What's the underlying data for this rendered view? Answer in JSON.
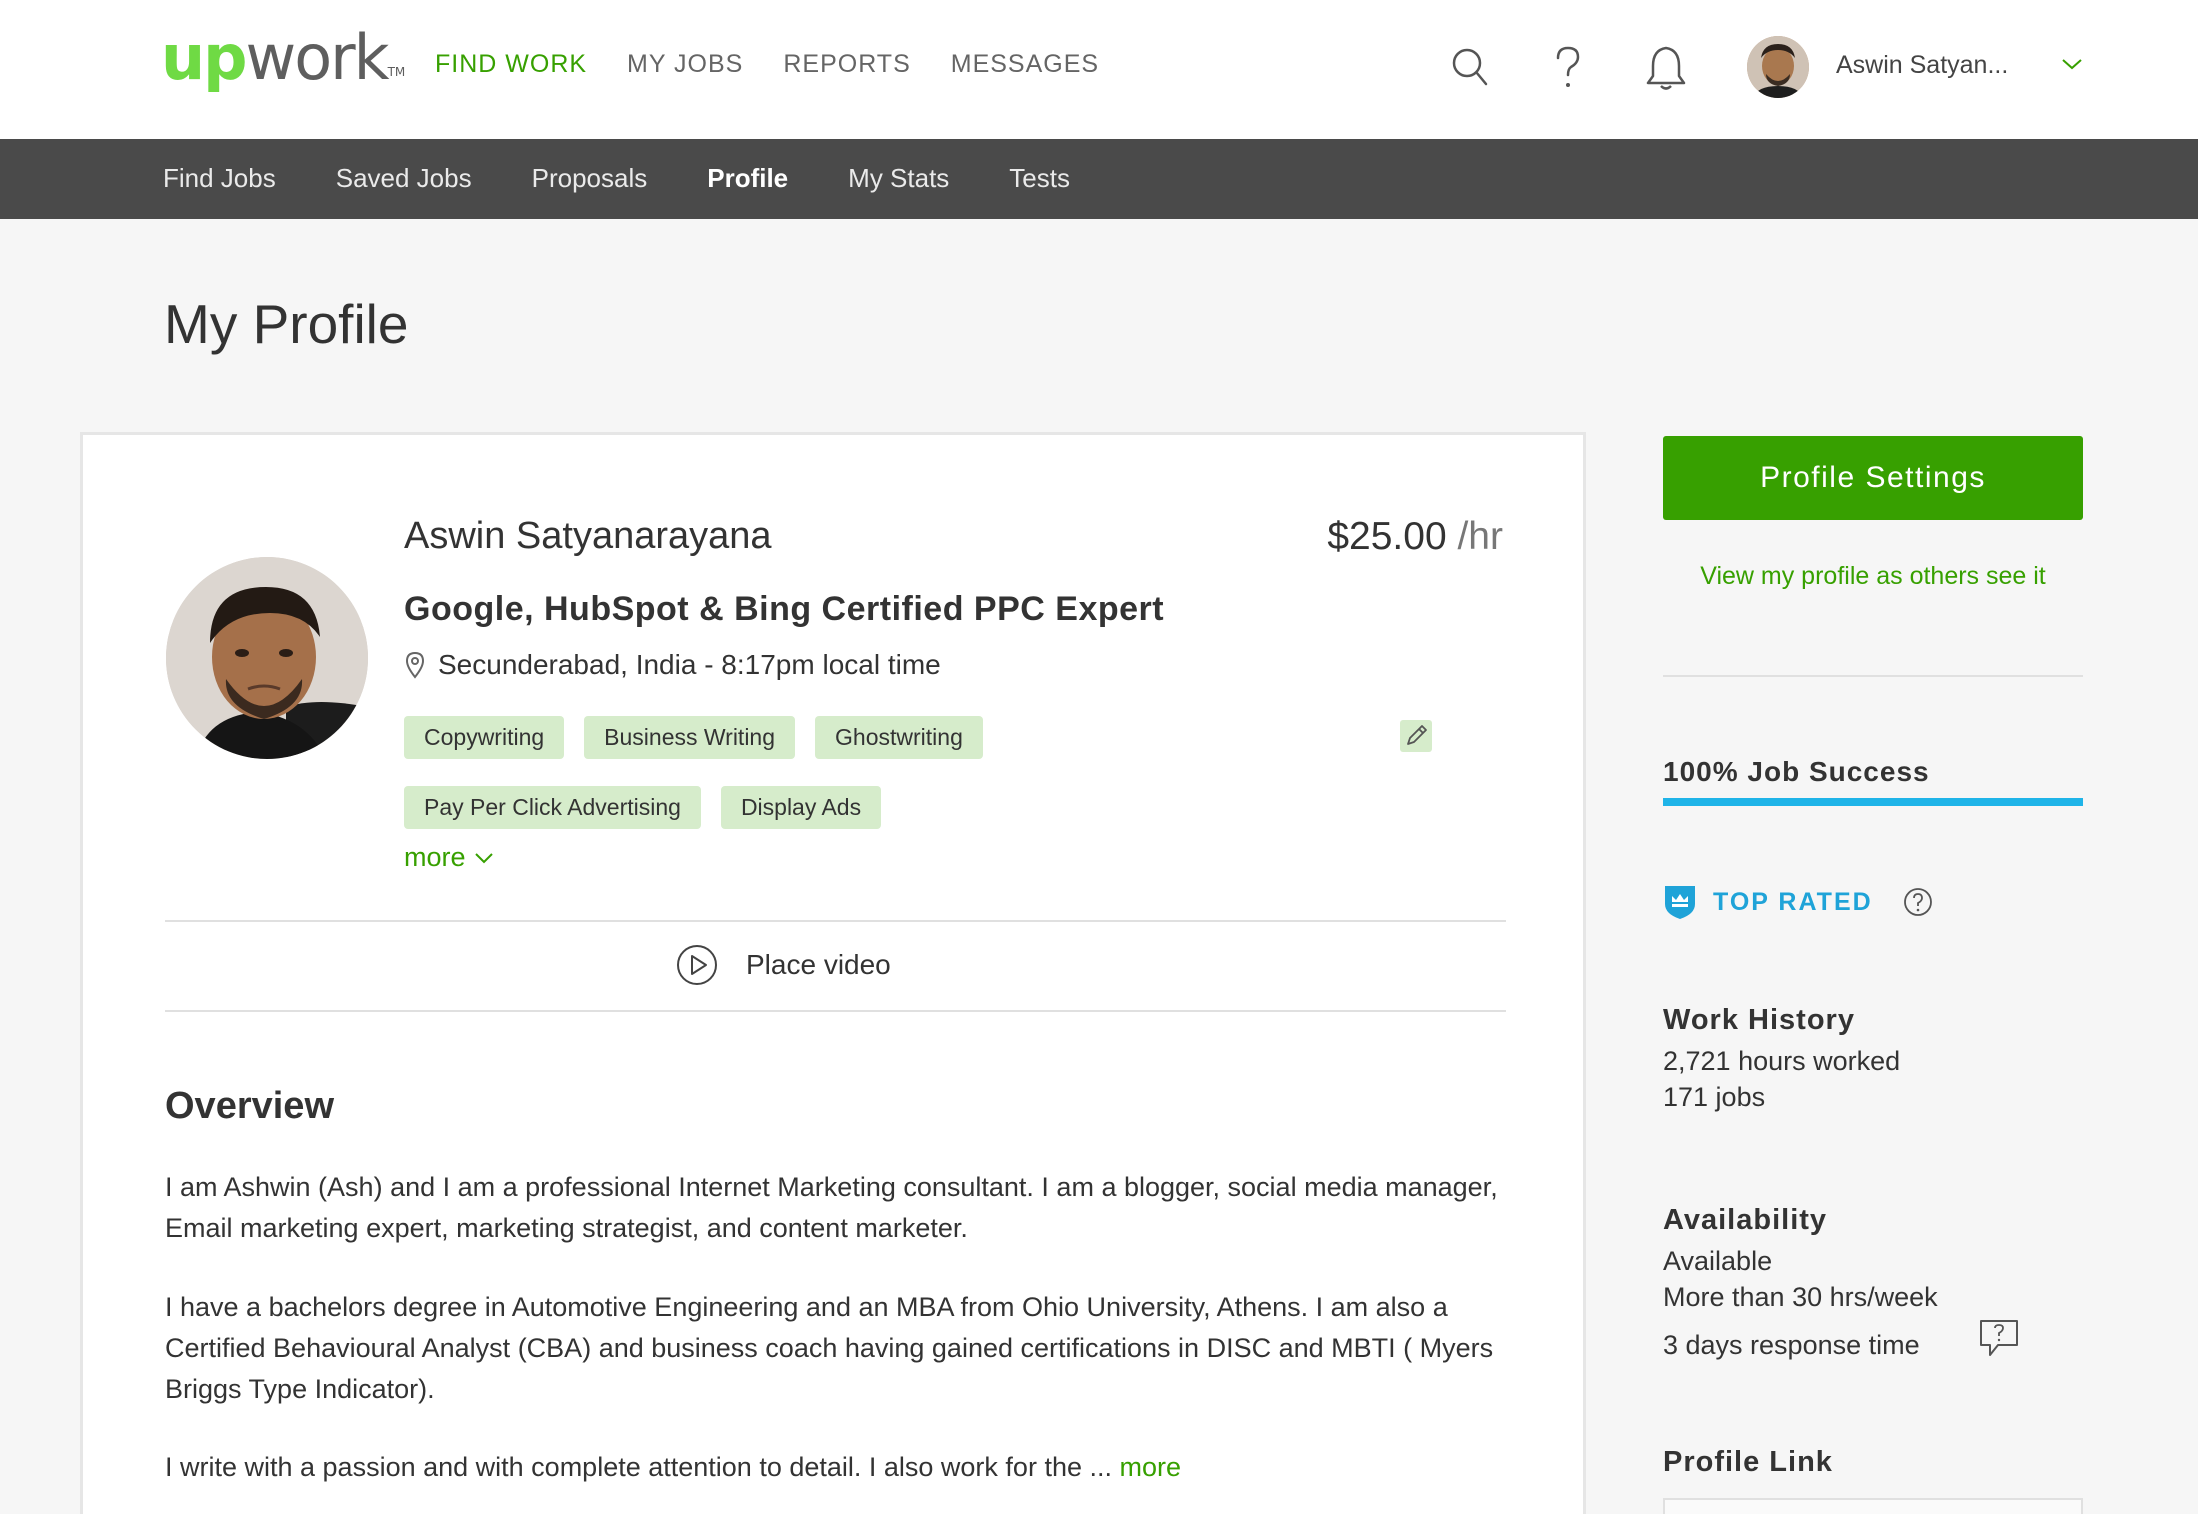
{
  "brand": {
    "logo_up": "up",
    "logo_work": "work",
    "logo_tm": "TM"
  },
  "nav": {
    "main": [
      "FIND WORK",
      "MY JOBS",
      "REPORTS",
      "MESSAGES"
    ],
    "active": "FIND WORK",
    "icons": [
      "search-icon",
      "help-icon",
      "bell-icon"
    ],
    "user_name": "Aswin Satyan..."
  },
  "subnav": {
    "items": [
      "Find Jobs",
      "Saved Jobs",
      "Proposals",
      "Profile",
      "My Stats",
      "Tests"
    ],
    "active": "Profile"
  },
  "page": {
    "title": "My Profile"
  },
  "profile": {
    "name": "Aswin Satyanarayana",
    "rate": "$25.00",
    "rate_unit": " /hr",
    "headline": "Google, HubSpot & Bing Certified PPC Expert",
    "location": "Secunderabad, India - 8:17pm local time",
    "skills": [
      "Copywriting",
      "Business Writing",
      "Ghostwriting",
      "Pay Per Click Advertising",
      "Display Ads"
    ],
    "more_skills": "more",
    "video_label": "Place video"
  },
  "overview": {
    "title": "Overview",
    "paragraphs": [
      "I am Ashwin (Ash) and I am a professional Internet Marketing consultant. I am a blogger, social media manager, Email marketing expert, marketing strategist, and content marketer.",
      "I have a bachelors degree in Automotive Engineering and an MBA from Ohio University, Athens. I am also a Certified Behavioural Analyst (CBA) and business coach having gained certifications in DISC and MBTI ( Myers Briggs Type Indicator).",
      "I write with a passion and with complete attention to detail. I also work for the ..."
    ],
    "more": " more"
  },
  "sidebar": {
    "settings_button": "Profile Settings",
    "view_link": "View my profile as others see it",
    "job_success_label": "100% Job Success",
    "job_success_pct": 100,
    "top_rated": "TOP RATED",
    "work_history": {
      "title": "Work History",
      "hours": "2,721 hours worked",
      "jobs": "171 jobs"
    },
    "availability": {
      "title": "Availability",
      "status": "Available",
      "hours": "More than 30 hrs/week",
      "response": "3 days response time"
    },
    "profile_link_title": "Profile Link"
  },
  "colors": {
    "brand_green": "#37a000",
    "logo_green": "#6fda44",
    "tag_bg": "#d6eccb",
    "top_rated_blue": "#1fa3d8",
    "success_bar": "#1fb4e8",
    "subnav_bg": "#4a4a4a"
  }
}
